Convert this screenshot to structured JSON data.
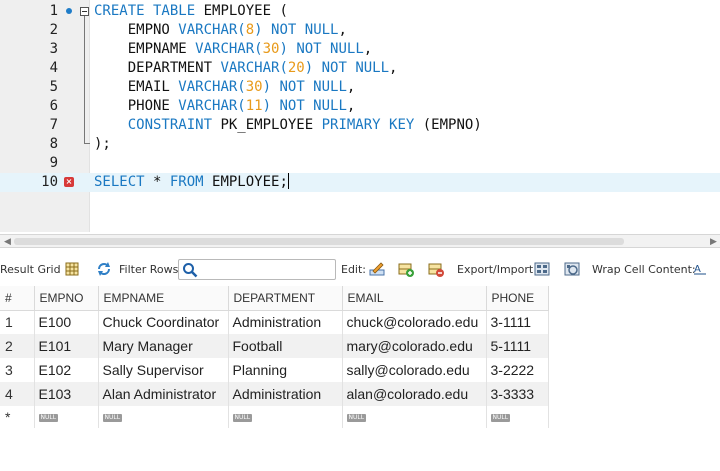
{
  "editor": {
    "lines": [
      {
        "n": "1",
        "tokens": [
          {
            "t": "CREATE TABLE",
            "c": "kw"
          },
          {
            "t": " EMPLOYEE (",
            "c": ""
          }
        ]
      },
      {
        "n": "2",
        "tokens": [
          {
            "t": "    EMPNO ",
            "c": ""
          },
          {
            "t": "VARCHAR(",
            "c": "kw"
          },
          {
            "t": "8",
            "c": "num"
          },
          {
            "t": ")",
            "c": "kw"
          },
          {
            "t": " ",
            "c": ""
          },
          {
            "t": "NOT NULL",
            "c": "kw"
          },
          {
            "t": ",",
            "c": ""
          }
        ]
      },
      {
        "n": "3",
        "tokens": [
          {
            "t": "    EMPNAME ",
            "c": ""
          },
          {
            "t": "VARCHAR(",
            "c": "kw"
          },
          {
            "t": "30",
            "c": "num"
          },
          {
            "t": ")",
            "c": "kw"
          },
          {
            "t": " ",
            "c": ""
          },
          {
            "t": "NOT NULL",
            "c": "kw"
          },
          {
            "t": ",",
            "c": ""
          }
        ]
      },
      {
        "n": "4",
        "tokens": [
          {
            "t": "    DEPARTMENT ",
            "c": ""
          },
          {
            "t": "VARCHAR(",
            "c": "kw"
          },
          {
            "t": "20",
            "c": "num"
          },
          {
            "t": ")",
            "c": "kw"
          },
          {
            "t": " ",
            "c": ""
          },
          {
            "t": "NOT NULL",
            "c": "kw"
          },
          {
            "t": ",",
            "c": ""
          }
        ]
      },
      {
        "n": "5",
        "tokens": [
          {
            "t": "    EMAIL ",
            "c": ""
          },
          {
            "t": "VARCHAR(",
            "c": "kw"
          },
          {
            "t": "30",
            "c": "num"
          },
          {
            "t": ")",
            "c": "kw"
          },
          {
            "t": " ",
            "c": ""
          },
          {
            "t": "NOT NULL",
            "c": "kw"
          },
          {
            "t": ",",
            "c": ""
          }
        ]
      },
      {
        "n": "6",
        "tokens": [
          {
            "t": "    PHONE ",
            "c": ""
          },
          {
            "t": "VARCHAR(",
            "c": "kw"
          },
          {
            "t": "11",
            "c": "num"
          },
          {
            "t": ")",
            "c": "kw"
          },
          {
            "t": " ",
            "c": ""
          },
          {
            "t": "NOT NULL",
            "c": "kw"
          },
          {
            "t": ",",
            "c": ""
          }
        ]
      },
      {
        "n": "7",
        "tokens": [
          {
            "t": "    ",
            "c": ""
          },
          {
            "t": "CONSTRAINT",
            "c": "kw"
          },
          {
            "t": " PK_EMPLOYEE ",
            "c": ""
          },
          {
            "t": "PRIMARY KEY",
            "c": "kw"
          },
          {
            "t": " (EMPNO)",
            "c": ""
          }
        ]
      },
      {
        "n": "8",
        "tokens": [
          {
            "t": ");",
            "c": ""
          }
        ]
      },
      {
        "n": "9",
        "tokens": []
      },
      {
        "n": "10",
        "tokens": [
          {
            "t": "SELECT",
            "c": "kw"
          },
          {
            "t": " * ",
            "c": ""
          },
          {
            "t": "FROM",
            "c": "kw"
          },
          {
            "t": " EMPLOYEE;",
            "c": ""
          }
        ]
      }
    ],
    "error_icon": "error-x-icon",
    "statement_icon": "statement-dot-icon"
  },
  "toolbar": {
    "result_grid": "Result Grid",
    "filter_rows": "Filter Rows:",
    "filter_value": "",
    "edit": "Edit:",
    "export_import": "Export/Import:",
    "wrap_cell": "Wrap Cell Content:"
  },
  "grid": {
    "columns": [
      "#",
      "EMPNO",
      "EMPNAME",
      "DEPARTMENT",
      "EMAIL",
      "PHONE"
    ],
    "rows": [
      [
        "1",
        "E100",
        "Chuck Coordinator",
        "Administration",
        "chuck@colorado.edu",
        "3-1111"
      ],
      [
        "2",
        "E101",
        "Mary Manager",
        "Football",
        "mary@colorado.edu",
        "5-1111"
      ],
      [
        "3",
        "E102",
        "Sally Supervisor",
        "Planning",
        "sally@colorado.edu",
        "3-2222"
      ],
      [
        "4",
        "E103",
        "Alan Administrator",
        "Administration",
        "alan@colorado.edu",
        "3-3333"
      ]
    ],
    "new_row_marker": "*",
    "null_label": "NULL"
  },
  "colors": {
    "keyword": "#1a78c2",
    "number": "#e89a1a",
    "active_line": "#e6f4fb",
    "error": "#d73a3a"
  }
}
